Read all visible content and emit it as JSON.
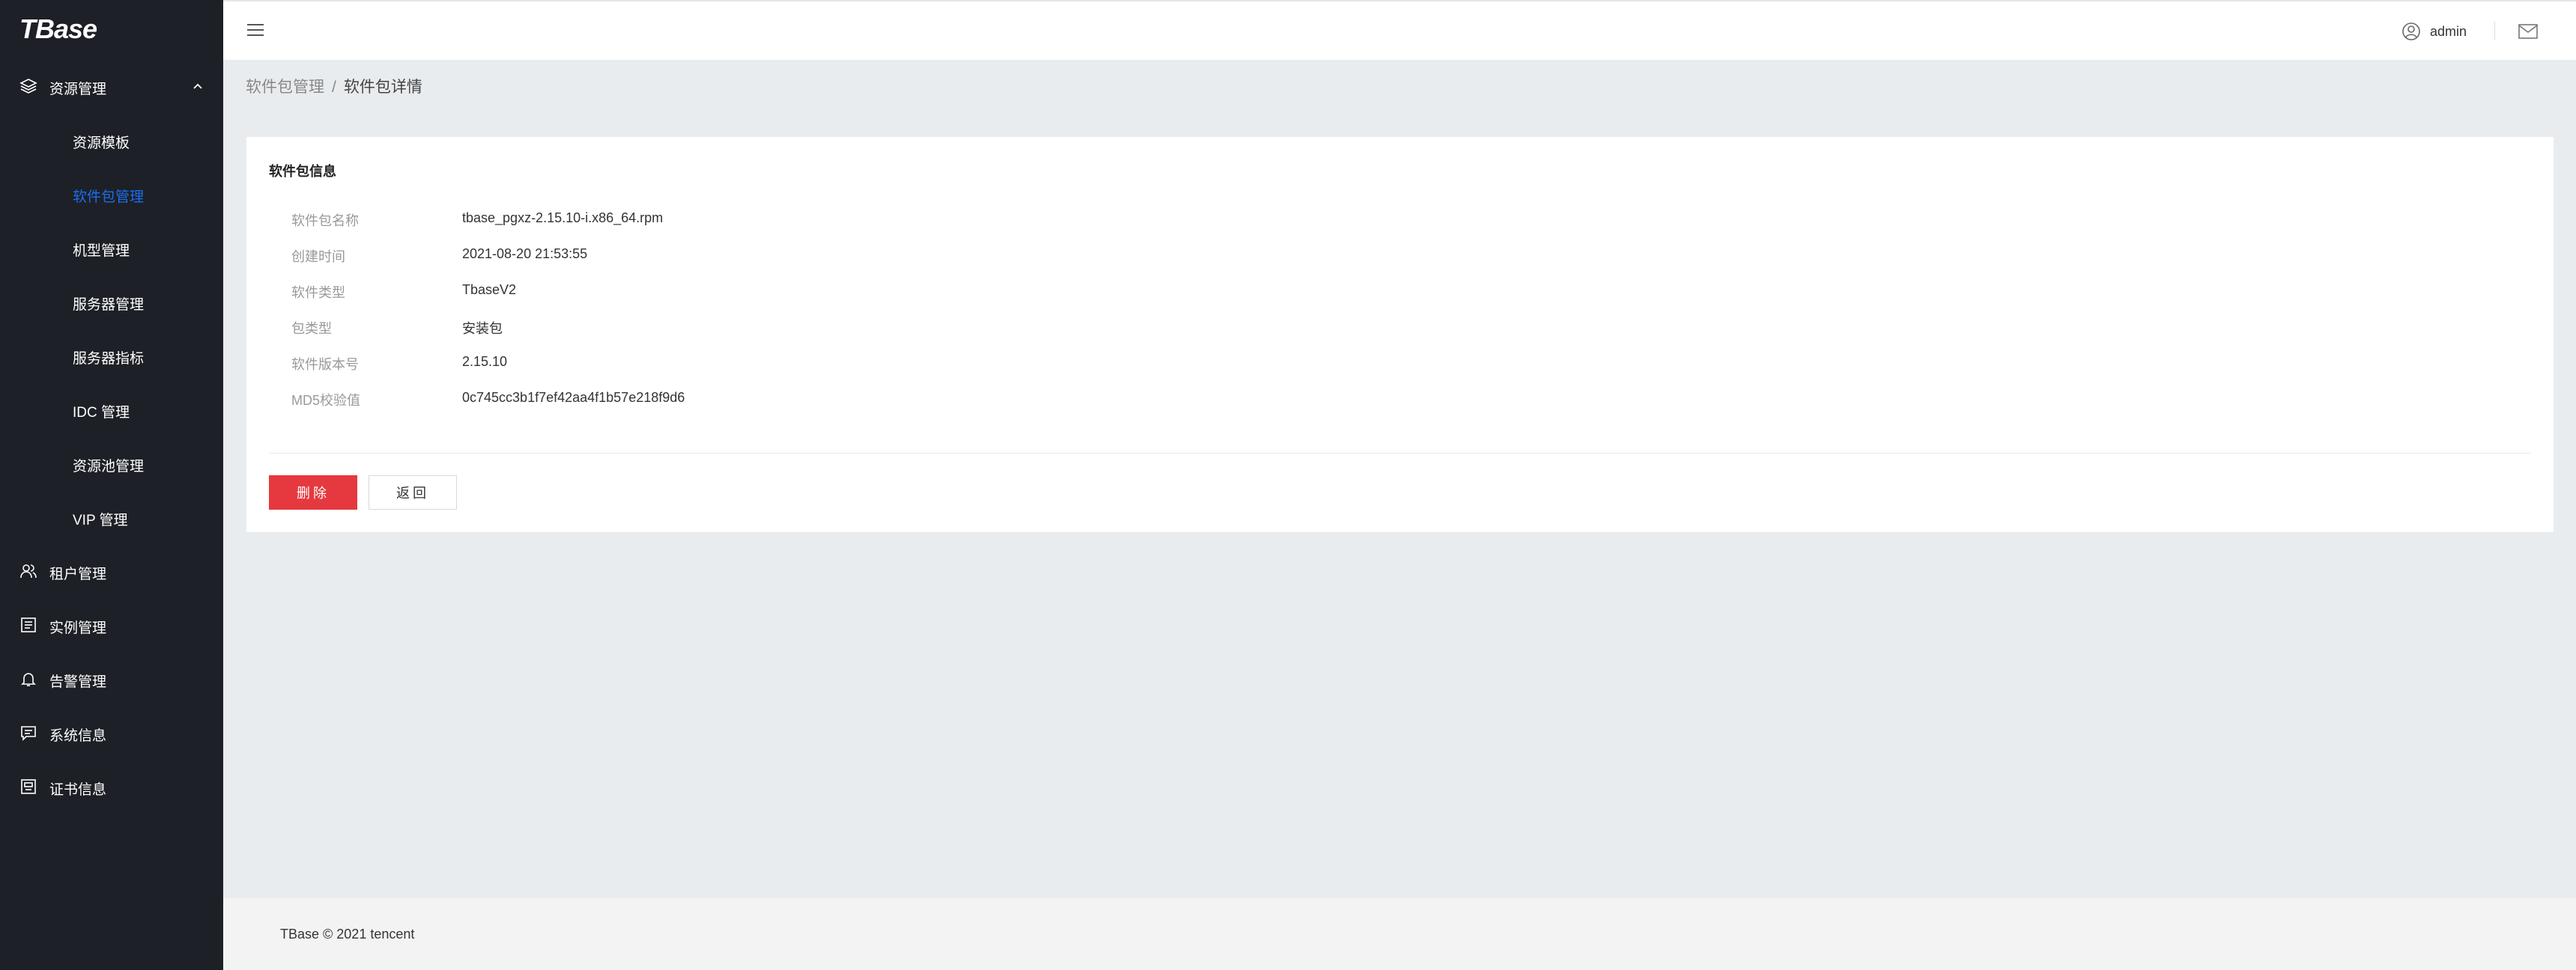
{
  "app": {
    "logo": "TBase"
  },
  "sidebar": {
    "groups": [
      {
        "label": "资源管理",
        "icon": "layers-icon",
        "expanded": true
      },
      {
        "label": "租户管理",
        "icon": "users-icon"
      },
      {
        "label": "实例管理",
        "icon": "list-icon"
      },
      {
        "label": "告警管理",
        "icon": "bell-icon"
      },
      {
        "label": "系统信息",
        "icon": "message-icon"
      },
      {
        "label": "证书信息",
        "icon": "certificate-icon"
      }
    ],
    "sub_items": [
      {
        "label": "资源模板"
      },
      {
        "label": "软件包管理",
        "active": true
      },
      {
        "label": "机型管理"
      },
      {
        "label": "服务器管理"
      },
      {
        "label": "服务器指标"
      },
      {
        "label": "IDC 管理"
      },
      {
        "label": "资源池管理"
      },
      {
        "label": "VIP 管理"
      }
    ]
  },
  "header": {
    "user": "admin",
    "icons": [
      "menu-icon",
      "user-icon",
      "mail-icon"
    ]
  },
  "breadcrumb": {
    "parent": "软件包管理",
    "separator": "/",
    "current": "软件包详情"
  },
  "panel": {
    "title": "软件包信息",
    "rows": [
      {
        "key": "软件包名称",
        "value": "tbase_pgxz-2.15.10-i.x86_64.rpm"
      },
      {
        "key": "创建时间",
        "value": "2021-08-20 21:53:55"
      },
      {
        "key": "软件类型",
        "value": "TbaseV2"
      },
      {
        "key": "包类型",
        "value": "安装包"
      },
      {
        "key": "软件版本号",
        "value": "2.15.10"
      },
      {
        "key": "MD5校验值",
        "value": "0c745cc3b1f7ef42aa4f1b57e218f9d6"
      }
    ],
    "delete_label": "删除",
    "back_label": "返回"
  },
  "footer": {
    "text": "TBase © 2021 tencent"
  },
  "colors": {
    "sidebar_bg": "#1d2026",
    "active": "#1a6ef0",
    "danger": "#e5393f"
  }
}
